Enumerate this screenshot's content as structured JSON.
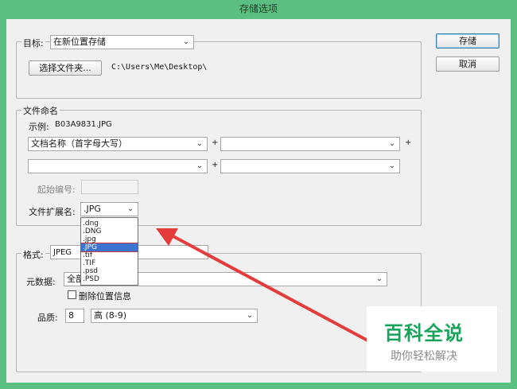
{
  "window": {
    "title": "存储选项"
  },
  "buttons": {
    "save": "存储",
    "cancel": "取消"
  },
  "target": {
    "label": "目标:",
    "location_value": "在新位置存储",
    "choose_folder_button": "选择文件夹...",
    "path": "C:\\Users\\Me\\Desktop\\"
  },
  "naming": {
    "group_label": "文件命名",
    "example_label": "示例:",
    "example_value": "B03A9831.JPG",
    "field1_value": "文档名称（首字母大写）",
    "field2_value": "",
    "field3_value": "",
    "field4_value": "",
    "plus": "+",
    "start_number_label": "起始编号:",
    "start_number_value": "",
    "extension_label": "文件扩展名:",
    "extension_value": ".JPG",
    "extension_options": [
      ".dng",
      ".DNG",
      ".jpg",
      ".JPG",
      ".tif",
      ".TIF",
      ".psd",
      ".PSD"
    ],
    "extension_selected_index": 3
  },
  "format": {
    "label": "格式:",
    "value": "JPEG",
    "metadata_label": "元数据:",
    "metadata_value": "全部",
    "remove_location_label": "删除位置信息",
    "remove_location_checked": false,
    "quality_label": "品质:",
    "quality_value": "8",
    "quality_level": "高  (8-9)"
  },
  "watermark": {
    "title": "百科全说",
    "subtitle": "助你轻松解决"
  },
  "colors": {
    "titlebar": "#5cbf82",
    "selection": "#3d74d0",
    "arrow": "#e23c3c",
    "watermark_green": "#18a35a"
  }
}
